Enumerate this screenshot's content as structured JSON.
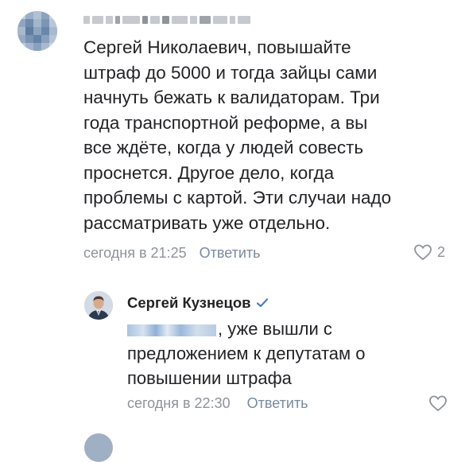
{
  "comments": [
    {
      "author_name_blurred": "",
      "text": "Сергей Николаевич, повышайте\nштраф до 5000 и тогда зайцы сами\nначнуть бежать к валидаторам. Три\nгода транспортной реформе, а вы\nвсе ждёте, когда у людей совесть\nпроснется. Другое дело, когда\nпроблемы с картой. Эти случаи надо\nрассматривать уже отдельно.",
      "time": "сегодня в 21:25",
      "reply_label": "Ответить",
      "likes": "2",
      "icon": "heart-icon"
    },
    {
      "author_name": "Сергей Кузнецов",
      "verified_icon": "verified-checkmark-icon",
      "mention_blurred": "",
      "lines": [
        ", уже вышли с",
        "предложением к депутатам о",
        "повышении штрафа"
      ],
      "time": "сегодня в 22:30",
      "reply_label": "Ответить",
      "icon": "heart-icon"
    }
  ],
  "colors": {
    "text": "#222326",
    "muted": "#8d939b",
    "accent": "#4a7ec0"
  }
}
